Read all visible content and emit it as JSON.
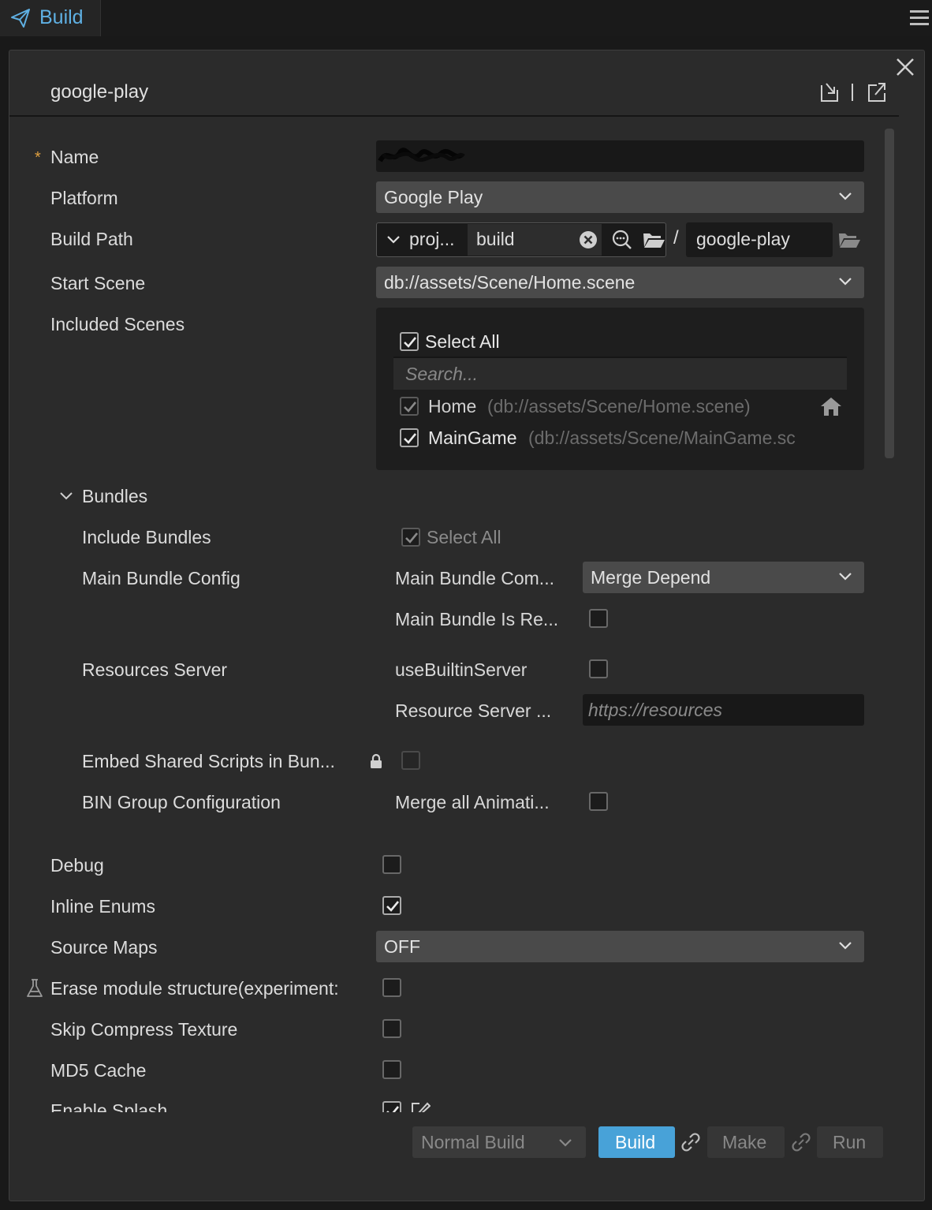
{
  "tab": {
    "label": "Build"
  },
  "panel": {
    "title": "google-play"
  },
  "form": {
    "name_required_mark": "*",
    "name_label": "Name",
    "platform_label": "Platform",
    "platform_value": "Google Play",
    "build_path_label": "Build Path",
    "build_path_root": "proj...",
    "build_path_dir": "build",
    "build_path_separator": "/",
    "build_path_output": "google-play",
    "start_scene_label": "Start Scene",
    "start_scene_value": "db://assets/Scene/Home.scene",
    "included_scenes_label": "Included Scenes",
    "scenes": {
      "select_all_label": "Select All",
      "select_all_checked": true,
      "search_placeholder": "Search...",
      "items": [
        {
          "name": "Home",
          "path": "(db://assets/Scene/Home.scene)",
          "checked": true,
          "disabled": true,
          "is_start": true
        },
        {
          "name": "MainGame",
          "path": "(db://assets/Scene/MainGame.sc",
          "checked": true,
          "disabled": false,
          "is_start": false
        }
      ]
    },
    "bundles": {
      "section_label": "Bundles",
      "include_bundles_label": "Include Bundles",
      "include_select_all_label": "Select All",
      "include_select_all_checked": true,
      "main_bundle_config_label": "Main Bundle Config",
      "main_bundle_compression_label": "Main Bundle Com...",
      "main_bundle_compression_value": "Merge Depend",
      "main_bundle_is_remote_label": "Main Bundle Is Re...",
      "main_bundle_is_remote_checked": false,
      "resources_server_label": "Resources Server",
      "use_builtin_server_label": "useBuiltinServer",
      "use_builtin_server_checked": false,
      "resource_server_url_label": "Resource Server ...",
      "resource_server_url_placeholder": "https://resources",
      "embed_shared_scripts_label": "Embed Shared Scripts in Bun...",
      "embed_shared_scripts_checked": false,
      "bin_group_label": "BIN Group Configuration",
      "merge_animations_label": "Merge all Animati...",
      "merge_animations_checked": false
    },
    "debug_label": "Debug",
    "debug_checked": false,
    "inline_enums_label": "Inline Enums",
    "inline_enums_checked": true,
    "source_maps_label": "Source Maps",
    "source_maps_value": "OFF",
    "erase_module_label": "Erase module structure(experiment:",
    "erase_module_checked": false,
    "skip_compress_label": "Skip Compress Texture",
    "skip_compress_checked": false,
    "md5_cache_label": "MD5 Cache",
    "md5_cache_checked": false,
    "enable_splash_label": "Enable Splash",
    "enable_splash_checked": true
  },
  "footer": {
    "build_mode_value": "Normal Build",
    "build_label": "Build",
    "make_label": "Make",
    "run_label": "Run"
  },
  "colors": {
    "accent": "#48a2d8",
    "tab_text": "#5fb0e3",
    "required_mark": "#e0a040",
    "panel_bg": "#2b2b2b"
  }
}
